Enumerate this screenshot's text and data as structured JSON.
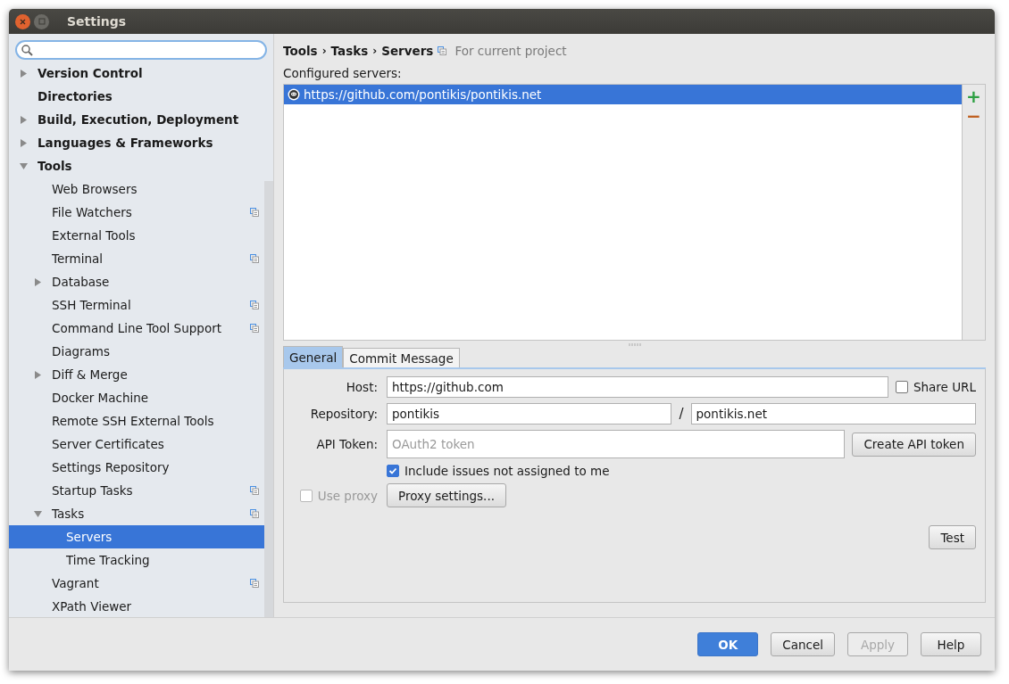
{
  "window": {
    "title": "Settings"
  },
  "sidebar": {
    "items": [
      {
        "label": "Version Control",
        "expanded": false,
        "selected": false
      },
      {
        "label": "Directories",
        "selected": false
      },
      {
        "label": "Build, Execution, Deployment",
        "expanded": false,
        "selected": false
      },
      {
        "label": "Languages & Frameworks",
        "expanded": false,
        "selected": false
      },
      {
        "label": "Tools",
        "expanded": true,
        "selected": false,
        "children": [
          {
            "label": "Web Browsers",
            "selected": false
          },
          {
            "label": "File Watchers",
            "selected": false,
            "project": true
          },
          {
            "label": "External Tools",
            "selected": false
          },
          {
            "label": "Terminal",
            "selected": false,
            "project": true
          },
          {
            "label": "Database",
            "expanded": false,
            "selected": false
          },
          {
            "label": "SSH Terminal",
            "selected": false,
            "project": true
          },
          {
            "label": "Command Line Tool Support",
            "selected": false,
            "project": true
          },
          {
            "label": "Diagrams",
            "selected": false
          },
          {
            "label": "Diff & Merge",
            "expanded": false,
            "selected": false
          },
          {
            "label": "Docker Machine",
            "selected": false
          },
          {
            "label": "Remote SSH External Tools",
            "selected": false
          },
          {
            "label": "Server Certificates",
            "selected": false
          },
          {
            "label": "Settings Repository",
            "selected": false
          },
          {
            "label": "Startup Tasks",
            "selected": false,
            "project": true
          },
          {
            "label": "Tasks",
            "expanded": true,
            "selected": false,
            "project": true,
            "children": [
              {
                "label": "Servers",
                "selected": true
              },
              {
                "label": "Time Tracking",
                "selected": false
              }
            ]
          },
          {
            "label": "Vagrant",
            "selected": false,
            "project": true
          },
          {
            "label": "XPath Viewer",
            "selected": false
          }
        ]
      }
    ]
  },
  "breadcrumb": [
    "Tools",
    "Tasks",
    "Servers"
  ],
  "breadcrumb_separators": [
    "›",
    "›"
  ],
  "scope_note": "For current project",
  "servers_label": "Configured servers:",
  "servers": [
    {
      "url": "https://github.com/pontikis/pontikis.net",
      "selected": true
    }
  ],
  "server_actions": [
    "+",
    "−"
  ],
  "tabs": [
    {
      "label": "General",
      "selected": true
    },
    {
      "label": "Commit Message",
      "selected": false
    }
  ],
  "form": {
    "host_label": "Host:",
    "host_value": "https://github.com",
    "share_url": {
      "label": "Share URL",
      "checked": false
    },
    "repository_label": "Repository:",
    "repo_owner": "pontikis",
    "repo_separator": "/",
    "repo_name": "pontikis.net",
    "token_label": "API Token:",
    "token_placeholder": "OAuth2 token",
    "create_token_button": "Create API token",
    "include_issues": {
      "label": "Include issues not assigned to me",
      "checked": true
    },
    "use_proxy": {
      "label": "Use proxy",
      "checked": false,
      "disabled": true
    },
    "proxy_button": "Proxy settings...",
    "test_button": "Test"
  },
  "buttons": [
    {
      "label": "OK",
      "kind": "default",
      "disabled": false
    },
    {
      "label": "Cancel",
      "kind": "normal",
      "disabled": false
    },
    {
      "label": "Apply",
      "kind": "normal",
      "disabled": true
    },
    {
      "label": "Help",
      "kind": "normal",
      "disabled": false
    }
  ]
}
